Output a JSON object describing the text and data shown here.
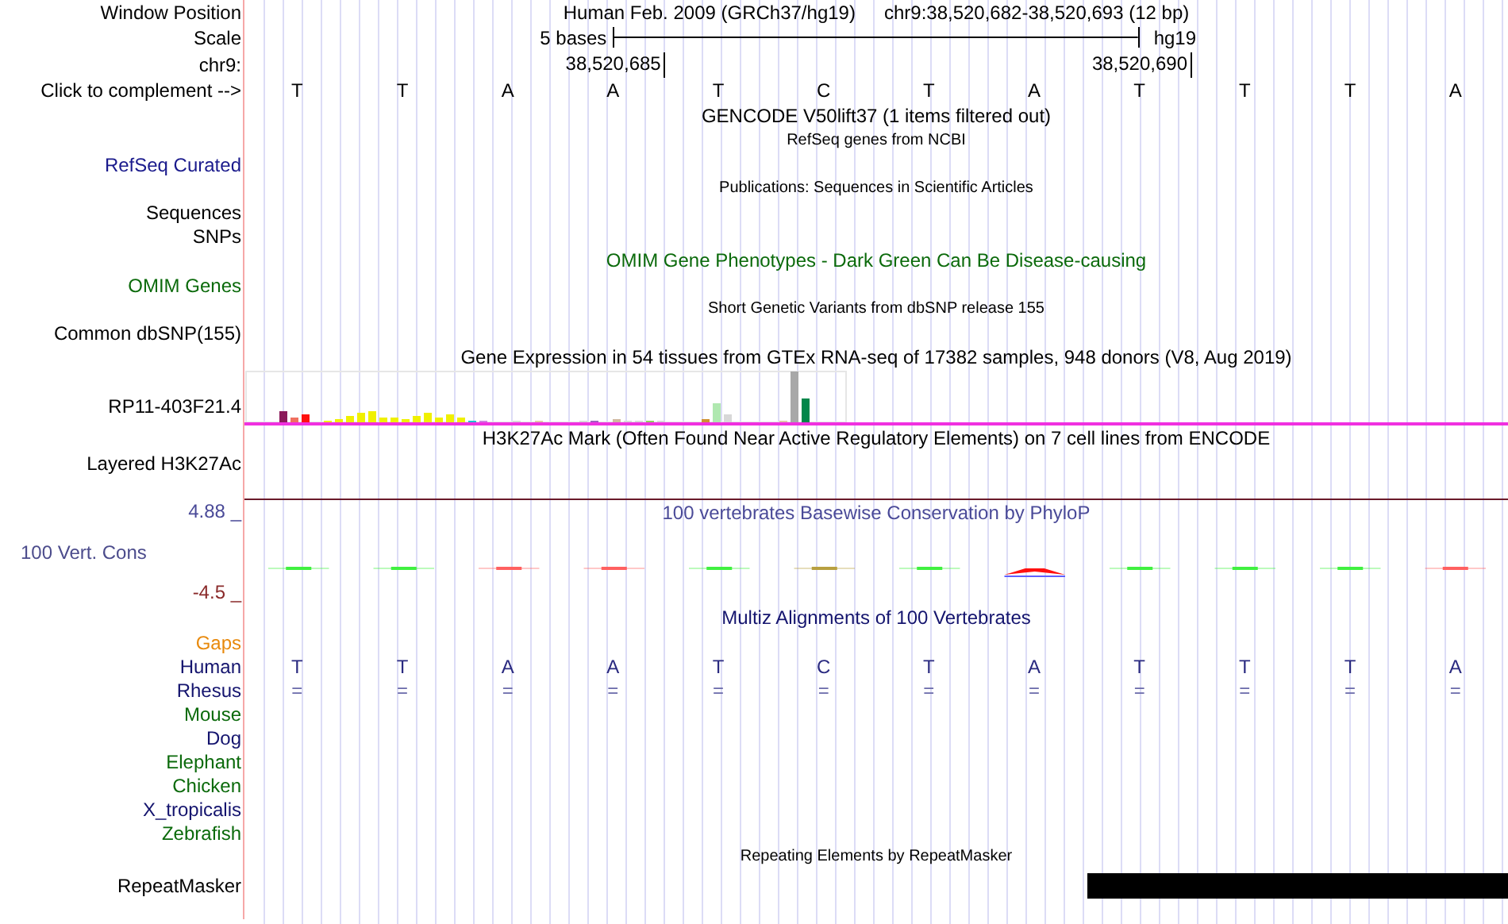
{
  "position_header": {
    "label": "Window Position",
    "assembly": "Human Feb. 2009 (GRCh37/hg19)",
    "position": "chr9:38,520,682-38,520,693 (12 bp)"
  },
  "scale": {
    "label": "Scale",
    "span": "5 bases",
    "db": "hg19"
  },
  "coordinates": {
    "label": "chr9:",
    "ticks": [
      "38,520,685",
      "38,520,690"
    ]
  },
  "sequence": {
    "label": "Click to complement -->",
    "bases": [
      "T",
      "T",
      "A",
      "A",
      "T",
      "C",
      "T",
      "A",
      "T",
      "T",
      "T",
      "A"
    ]
  },
  "tracks": [
    {
      "kind": "title",
      "title": "GENCODE V50lift37 (1 items filtered out)",
      "color": "#000000"
    },
    {
      "kind": "small_title",
      "title": "RefSeq genes from NCBI",
      "color": "#000000"
    },
    {
      "kind": "label",
      "label": "RefSeq Curated",
      "color": "#1a1a8c"
    },
    {
      "kind": "small_title",
      "title": "Publications: Sequences in Scientific Articles",
      "color": "#000000"
    },
    {
      "kind": "label",
      "label": "Sequences",
      "color": "#000000"
    },
    {
      "kind": "label",
      "label": "SNPs",
      "color": "#000000"
    },
    {
      "kind": "title",
      "title": "OMIM Gene Phenotypes - Dark Green Can Be Disease-causing",
      "color": "#0b6a0b"
    },
    {
      "kind": "label",
      "label": "OMIM Genes",
      "color": "#0b6a0b"
    },
    {
      "kind": "small_title",
      "title": "Short Genetic Variants from dbSNP release 155",
      "color": "#000000"
    },
    {
      "kind": "label",
      "label": "Common dbSNP(155)",
      "color": "#000000"
    },
    {
      "kind": "title",
      "title": "Gene Expression in 54 tissues from GTEx RNA-seq of 17382 samples, 948 donors (V8, Aug 2019)",
      "color": "#000000"
    },
    {
      "kind": "expression",
      "label": "RP11-403F21.4"
    },
    {
      "kind": "title",
      "title": "H3K27Ac Mark (Often Found Near Active Regulatory Elements) on 7 cell lines from ENCODE",
      "color": "#000000"
    },
    {
      "kind": "label",
      "label": "Layered H3K27Ac",
      "color": "#000000"
    },
    {
      "kind": "rule"
    },
    {
      "kind": "conservation",
      "title": "100 vertebrates Basewise Conservation by PhyloP",
      "label": "100 Vert. Cons",
      "max": "4.88 _",
      "min": "-4.5 _"
    },
    {
      "kind": "title",
      "title": "Multiz Alignments of 100 Vertebrates",
      "color": "#14146e"
    },
    {
      "kind": "species",
      "label": "Gaps",
      "color": "#e8890c"
    },
    {
      "kind": "species",
      "label": "Human",
      "color": "#14146e",
      "bases": [
        "T",
        "T",
        "A",
        "A",
        "T",
        "C",
        "T",
        "A",
        "T",
        "T",
        "T",
        "A"
      ]
    },
    {
      "kind": "species",
      "label": "Rhesus",
      "color": "#14146e",
      "bases": [
        "=",
        "=",
        "=",
        "=",
        "=",
        "=",
        "=",
        "=",
        "=",
        "=",
        "=",
        "="
      ]
    },
    {
      "kind": "species",
      "label": "Mouse",
      "color": "#0b6a0b"
    },
    {
      "kind": "species",
      "label": "Dog",
      "color": "#14146e"
    },
    {
      "kind": "species",
      "label": "Elephant",
      "color": "#0b6a0b"
    },
    {
      "kind": "species",
      "label": "Chicken",
      "color": "#0b6a0b"
    },
    {
      "kind": "species",
      "label": "X_tropicalis",
      "color": "#14146e"
    },
    {
      "kind": "species",
      "label": "Zebrafish",
      "color": "#0b6a0b"
    },
    {
      "kind": "small_title",
      "title": "Repeating Elements by RepeatMasker",
      "color": "#000000"
    },
    {
      "kind": "repeatmasker",
      "label": "RepeatMasker"
    }
  ]
}
